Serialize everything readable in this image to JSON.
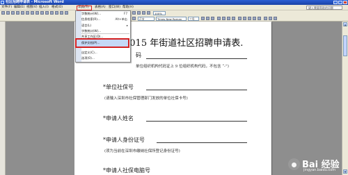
{
  "titlebar": {
    "title": "社区招聘申请表 - Microsoft Word"
  },
  "menubar": {
    "items": [
      {
        "label": "文件(F)"
      },
      {
        "label": "编辑(E)"
      },
      {
        "label": "视图(V)"
      },
      {
        "label": "插入(I)"
      },
      {
        "label": "格式(O)"
      },
      {
        "label": "工具(T)"
      },
      {
        "label": "表格(A)"
      },
      {
        "label": "窗口(W)"
      },
      {
        "label": "帮助(H)"
      }
    ],
    "help_box": "键入需要帮助的问题"
  },
  "toolbar": {
    "style_combo": "正文",
    "font_combo": "Times New Roman",
    "size_combo": "三号"
  },
  "tools_menu": {
    "items": [
      {
        "label": "字数统计(W)...",
        "shortcut": "F7"
      },
      {
        "label": "信息检索(R)...",
        "shortcut": "Alt+单击"
      },
      {
        "label": "语言(L)",
        "shortcut": ""
      },
      {
        "label": "字数统计(W)...",
        "shortcut": ""
      },
      {
        "label": "共享工作区(D)...",
        "shortcut": ""
      },
      {
        "label": "保护文档(P)...",
        "shortcut": ""
      },
      {
        "label": "自定义(C)...",
        "shortcut": ""
      },
      {
        "label": "选项(O)...",
        "shortcut": ""
      }
    ]
  },
  "document": {
    "title": "2015 年街道社区招聘申请表.",
    "fields": [
      {
        "label": "码",
        "note": "单位组织机构代码证上 9 位组织机构代码，不包含 “-”)"
      },
      {
        "label": "*单位社保号",
        "note": "(请输入深圳市社保管理部门发放的单位社保卡号)"
      },
      {
        "label": "*申请人姓名",
        "note": ""
      },
      {
        "label": "*申请人身份证号",
        "note": "(须为当前在深圳市缴纳社保所登记身份证号)"
      },
      {
        "label": "*申请人社保电脑号",
        "note": ""
      }
    ]
  },
  "watermark": {
    "cn": "Bai 经验",
    "en": "jingyan.baidu.com"
  }
}
